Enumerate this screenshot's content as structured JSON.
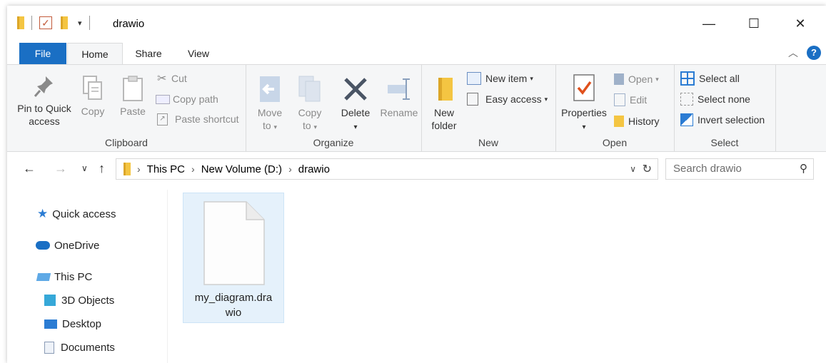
{
  "window": {
    "title": "drawio"
  },
  "window_controls": {
    "minimize": "—",
    "maximize": "☐",
    "close": "✕"
  },
  "tabs": {
    "file": "File",
    "home": "Home",
    "share": "Share",
    "view": "View"
  },
  "ribbon": {
    "clipboard": {
      "label": "Clipboard",
      "pin_line1": "Pin to Quick",
      "pin_line2": "access",
      "copy": "Copy",
      "paste": "Paste",
      "cut": "Cut",
      "copy_path": "Copy path",
      "paste_shortcut": "Paste shortcut"
    },
    "organize": {
      "label": "Organize",
      "move_line1": "Move",
      "move_line2": "to",
      "copy_line1": "Copy",
      "copy_line2": "to",
      "delete": "Delete",
      "rename": "Rename"
    },
    "new": {
      "label": "New",
      "new_folder_line1": "New",
      "new_folder_line2": "folder",
      "new_item": "New item",
      "easy_access": "Easy access"
    },
    "open": {
      "label": "Open",
      "properties": "Properties",
      "open": "Open",
      "edit": "Edit",
      "history": "History"
    },
    "select": {
      "label": "Select",
      "select_all": "Select all",
      "select_none": "Select none",
      "invert_selection": "Invert selection"
    }
  },
  "address": {
    "crumbs": [
      "This PC",
      "New Volume (D:)",
      "drawio"
    ],
    "search_placeholder": "Search drawio"
  },
  "nav": {
    "quick_access": "Quick access",
    "onedrive": "OneDrive",
    "this_pc": "This PC",
    "objects3d": "3D Objects",
    "desktop": "Desktop",
    "documents": "Documents"
  },
  "files": [
    {
      "name_line1": "my_diagram.dra",
      "name_line2": "wio"
    }
  ],
  "colors": {
    "accent": "#1a6fc4",
    "selection": "#e5f1fb",
    "folder": "#f4c542"
  }
}
